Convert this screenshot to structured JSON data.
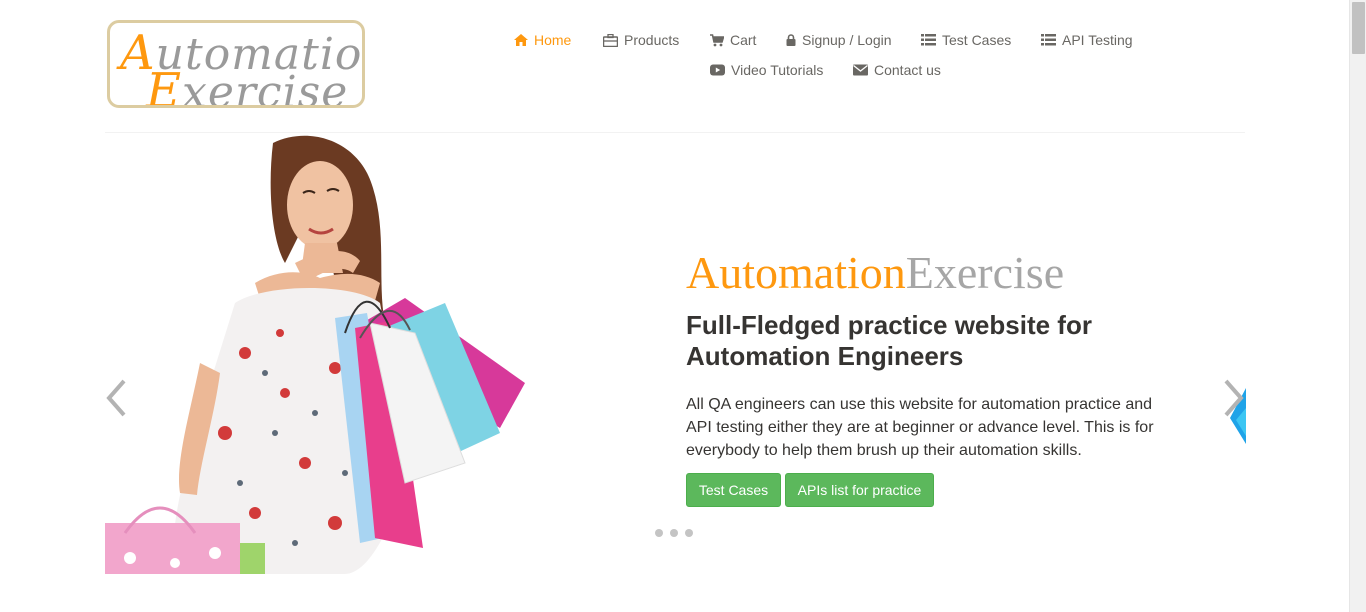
{
  "logo": {
    "line1_cap": "A",
    "line1_rest": "utomation",
    "line2_cap": "E",
    "line2_rest": "xercise"
  },
  "nav": {
    "home": "Home",
    "products": "Products",
    "cart": "Cart",
    "login": "Signup / Login",
    "test_cases": "Test Cases",
    "api_testing": "API Testing",
    "video_tutorials": "Video Tutorials",
    "contact": "Contact us"
  },
  "slider": {
    "brand_part1": "Automation",
    "brand_part2": "Exercise",
    "headline": "Full-Fledged practice website for Automation Engineers",
    "description": "All QA engineers can use this website for automation practice and API testing either they are at beginner or advance level. This is for everybody to help them brush up their automation skills.",
    "btn_test_cases": "Test Cases",
    "btn_apis": "APIs list for practice",
    "dots": 3
  },
  "colors": {
    "accent": "#fe980f",
    "button": "#5cb85c",
    "text": "#363432",
    "nav_text": "#696763"
  },
  "icons": [
    "home-icon",
    "briefcase-icon",
    "cart-icon",
    "lock-icon",
    "list-icon",
    "youtube-icon",
    "envelope-icon",
    "chevron-left-icon",
    "chevron-right-icon"
  ]
}
